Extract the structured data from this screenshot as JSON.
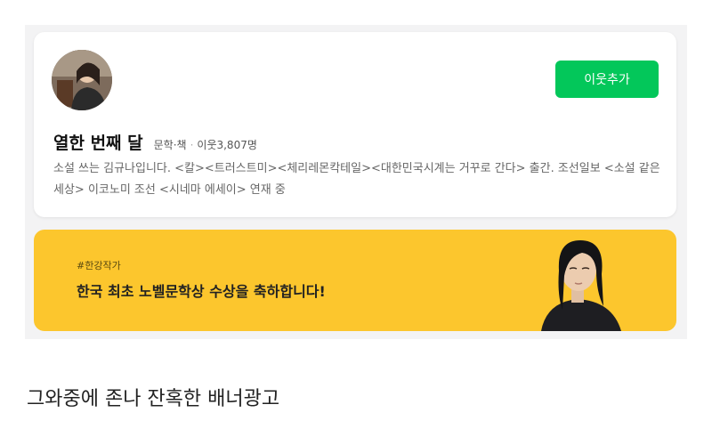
{
  "profile": {
    "avatar_icon": "author-portrait-icon",
    "follow_label": "이웃추가",
    "follow_color": "#03c75a",
    "blog_title": "열한 번째 달",
    "category": "문학·책",
    "neighbors": "이웃3,807명",
    "description": "소설 쓰는 김규나입니다. <칼><트러스트미><체리레몬칵테일><대한민국시계는 거꾸로 간다> 출간. 조선일보 <소설 같은 세상> 이코노미 조선 <시네마 에세이> 연재 중"
  },
  "banner": {
    "hashtag": "#한강작가",
    "headline": "한국 최초 노벨문학상 수상을 축하합니다!",
    "background_color": "#fcc62d",
    "photo_icon": "author-photo-icon"
  },
  "caption": "그와중에 존나 잔혹한 배너광고"
}
